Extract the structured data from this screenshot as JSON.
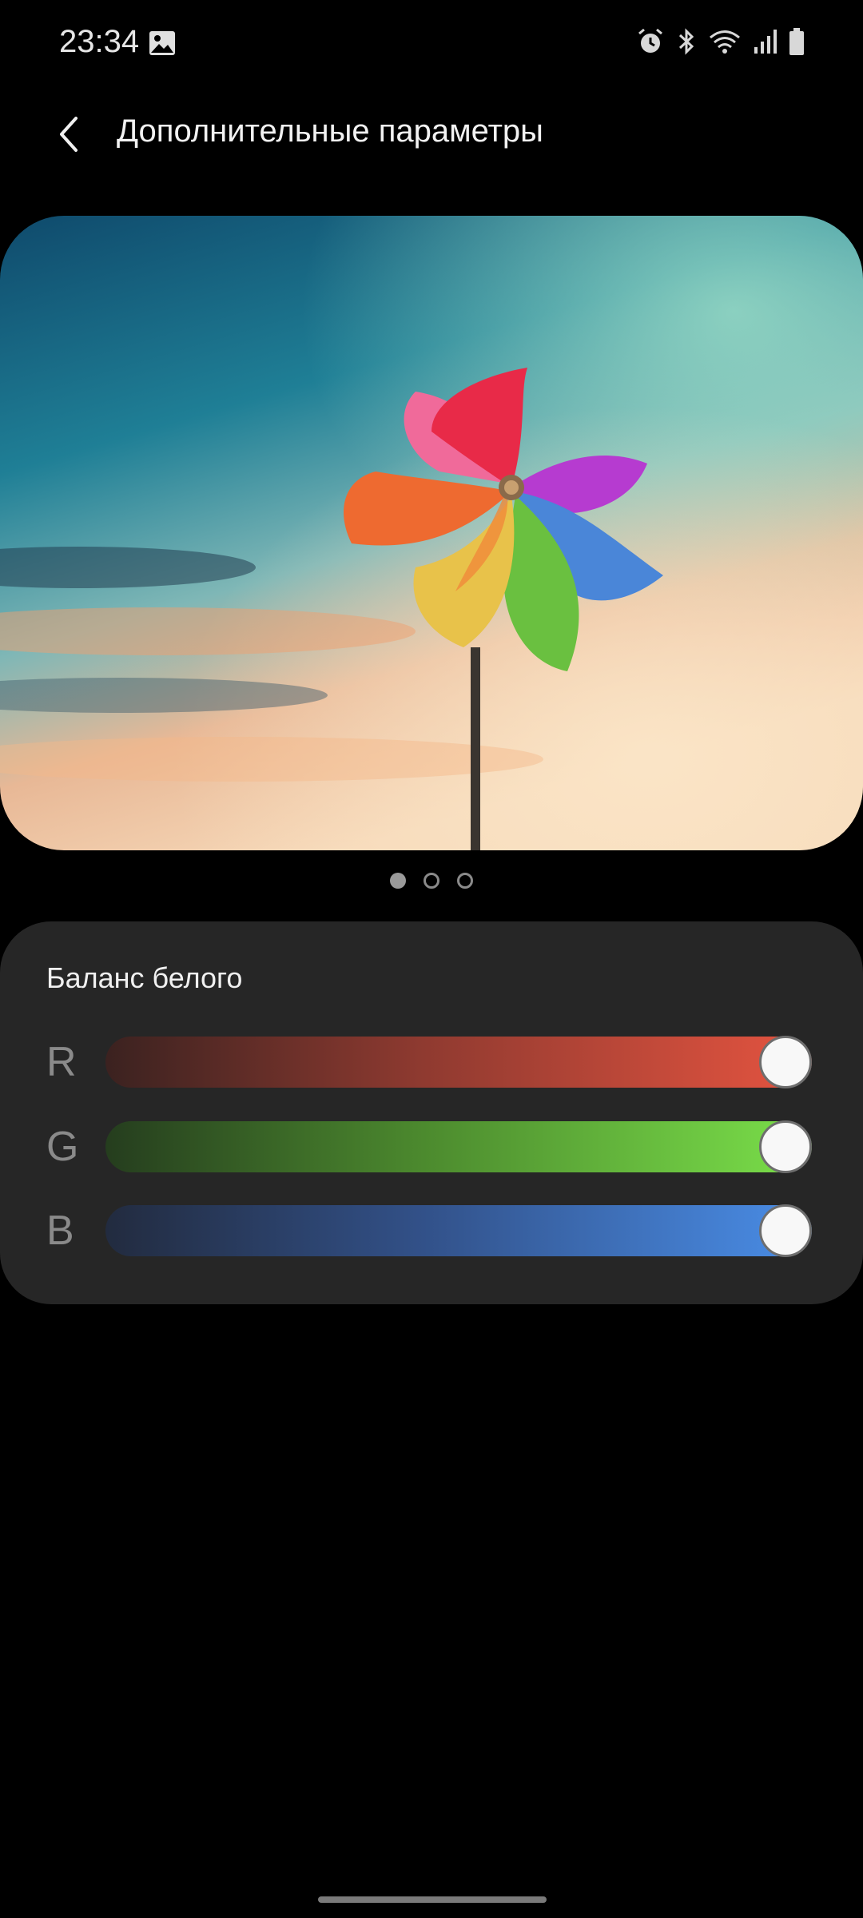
{
  "status_bar": {
    "time": "23:34",
    "icons": [
      "gallery-icon",
      "alarm-icon",
      "bluetooth-icon",
      "wifi-icon",
      "signal-icon",
      "battery-icon"
    ]
  },
  "header": {
    "title": "Дополнительные параметры",
    "back_icon": "back-arrow-icon"
  },
  "preview": {
    "image": "pinwheel-sky-photo",
    "pages": 3,
    "active_page": 1
  },
  "white_balance": {
    "title": "Баланс белого",
    "sliders": [
      {
        "label": "R",
        "value": 1.0,
        "color": "#e55440"
      },
      {
        "label": "G",
        "value": 1.0,
        "color": "#7be04a"
      },
      {
        "label": "B",
        "value": 1.0,
        "color": "#4a8ee8"
      }
    ]
  }
}
